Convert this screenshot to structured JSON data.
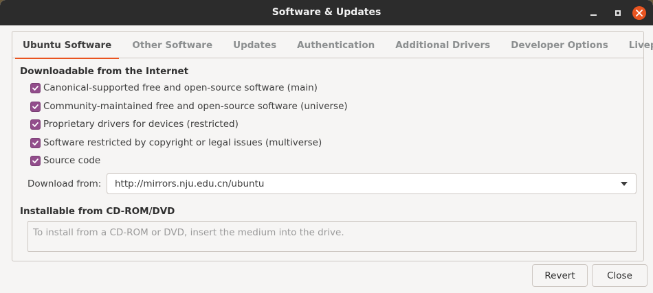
{
  "window": {
    "title": "Software & Updates",
    "controls": [
      "minimize-icon",
      "maximize-icon",
      "close-icon"
    ]
  },
  "tabs": [
    {
      "label": "Ubuntu Software",
      "active": true
    },
    {
      "label": "Other Software",
      "active": false
    },
    {
      "label": "Updates",
      "active": false
    },
    {
      "label": "Authentication",
      "active": false
    },
    {
      "label": "Additional Drivers",
      "active": false
    },
    {
      "label": "Developer Options",
      "active": false
    },
    {
      "label": "Livepatch",
      "active": false
    }
  ],
  "downloadable": {
    "heading": "Downloadable from the Internet",
    "items": [
      {
        "label": "Canonical-supported free and open-source software (main)",
        "checked": true
      },
      {
        "label": "Community-maintained free and open-source software (universe)",
        "checked": true
      },
      {
        "label": "Proprietary drivers for devices (restricted)",
        "checked": true
      },
      {
        "label": "Software restricted by copyright or legal issues (multiverse)",
        "checked": true
      },
      {
        "label": "Source code",
        "checked": true
      }
    ],
    "download_from_label": "Download from:",
    "download_from_value": "http://mirrors.nju.edu.cn/ubuntu"
  },
  "cdrom": {
    "heading": "Installable from CD-ROM/DVD",
    "placeholder": "To install from a CD-ROM or DVD, insert the medium into the drive."
  },
  "buttons": {
    "revert": "Revert",
    "close": "Close"
  },
  "colors": {
    "accent": "#e95420",
    "checkbox": "#924d8b",
    "titlebar": "#2c2c2c"
  }
}
